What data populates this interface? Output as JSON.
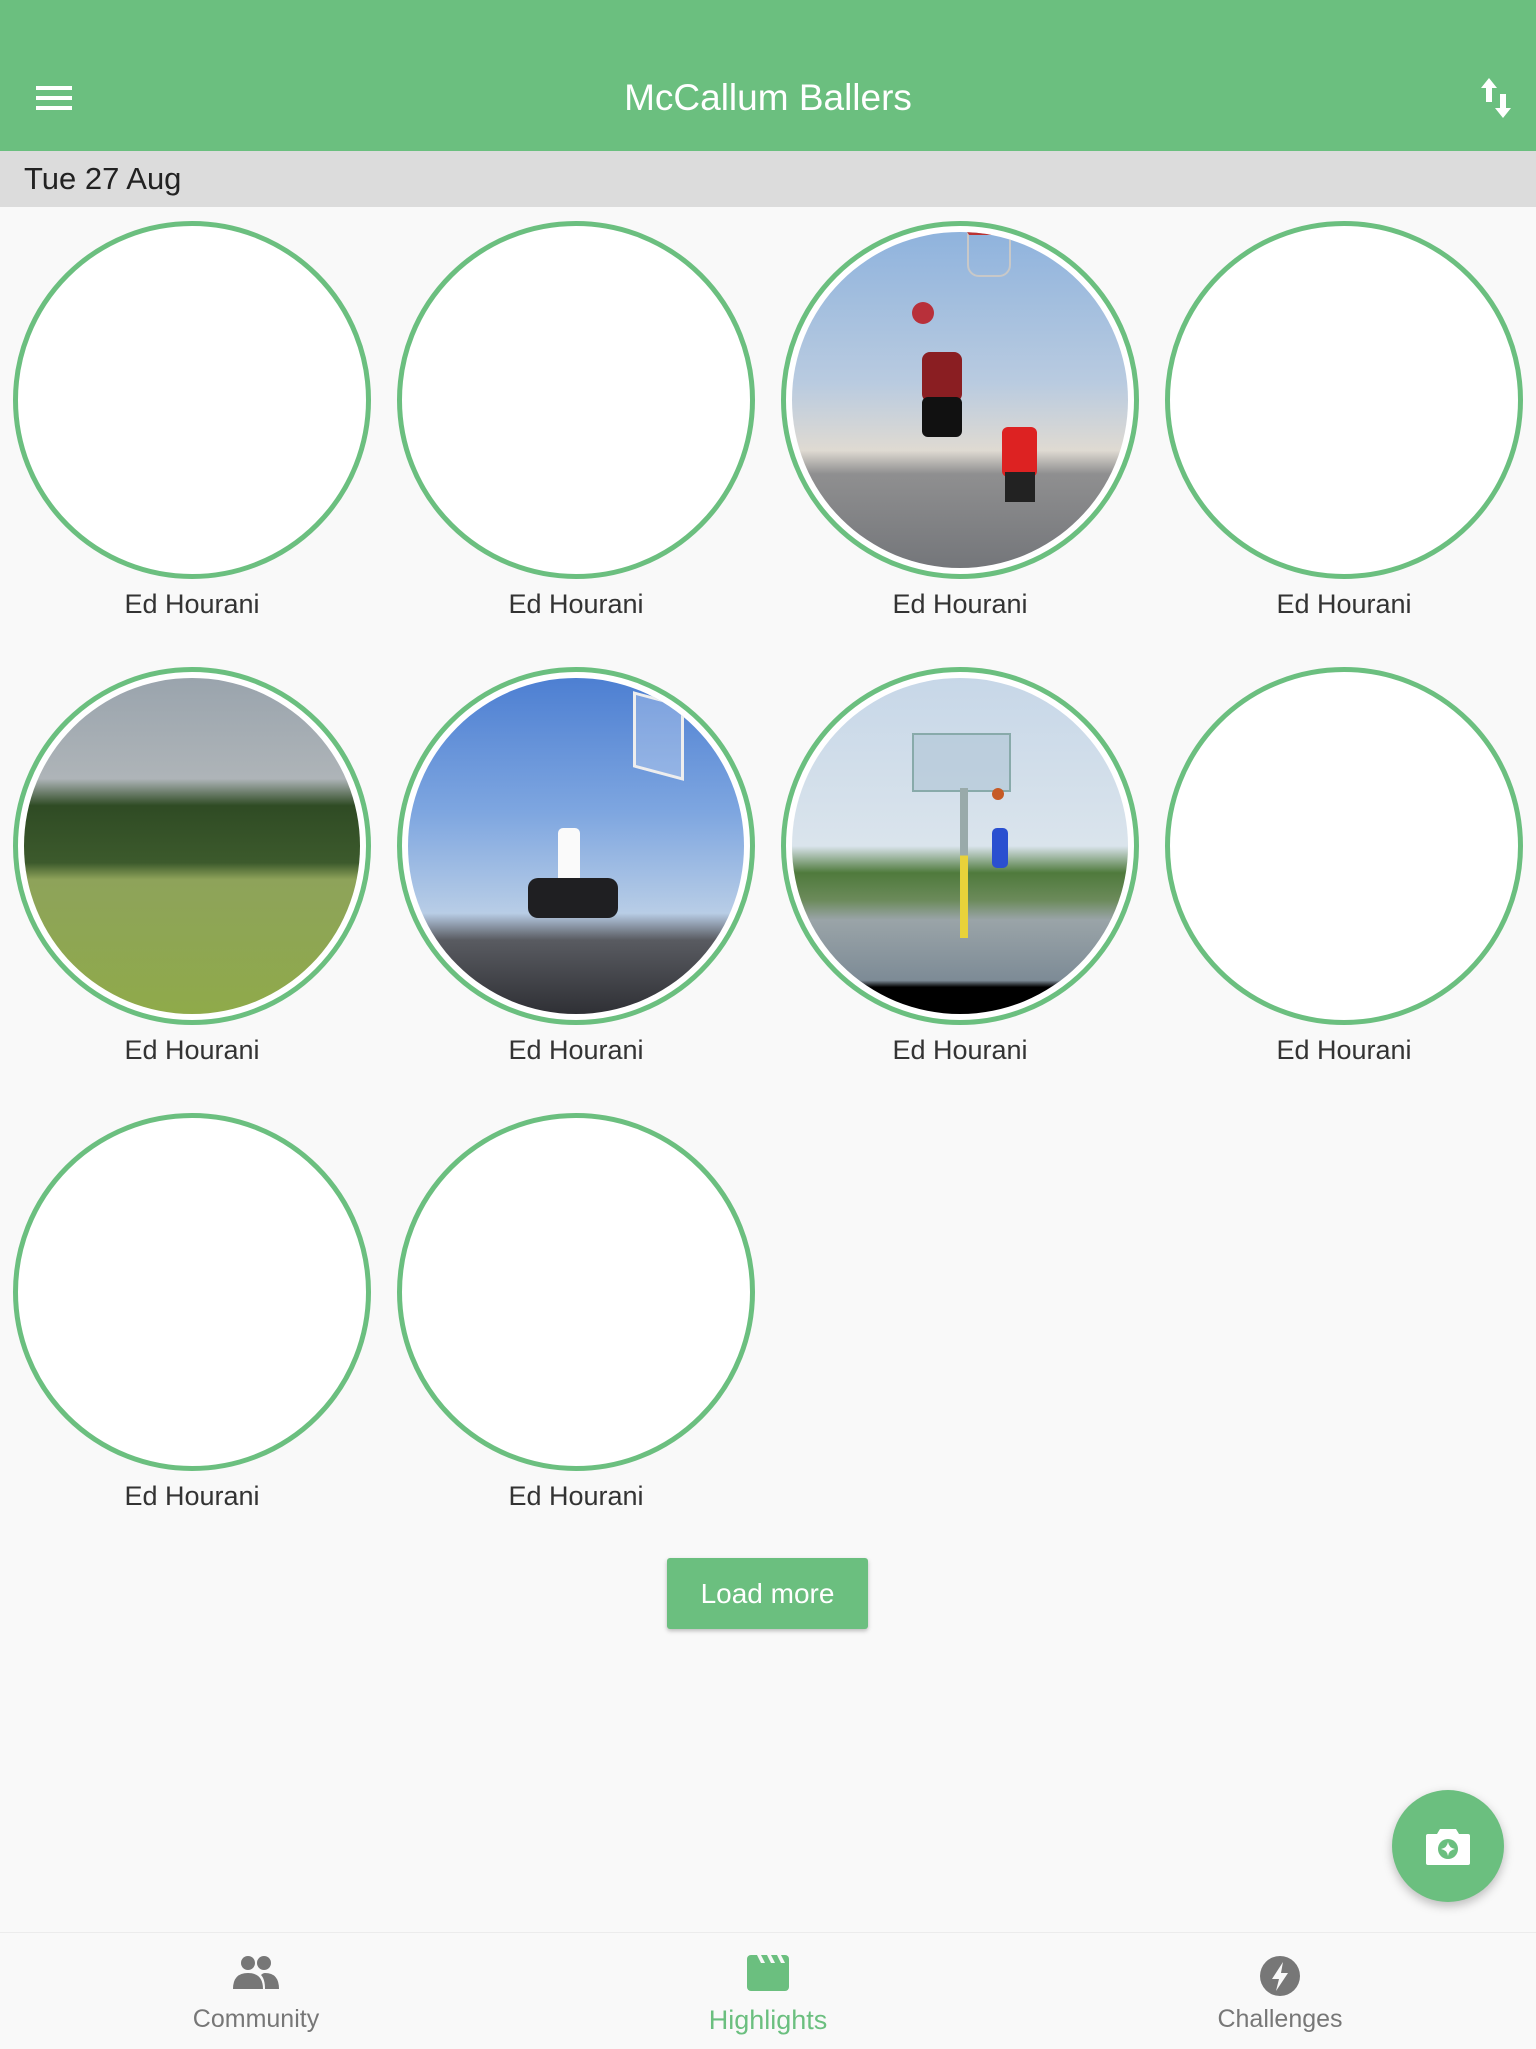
{
  "header": {
    "title": "McCallum Ballers",
    "menu_icon": "hamburger-menu-icon",
    "sort_icon": "swap-vertical-icon"
  },
  "date_header": "Tue 27 Aug",
  "highlights": [
    {
      "name": "Ed Hourani",
      "has_photo": false
    },
    {
      "name": "Ed Hourani",
      "has_photo": false
    },
    {
      "name": "Ed Hourani",
      "has_photo": true,
      "photo": "jump shot on outdoor court"
    },
    {
      "name": "Ed Hourani",
      "has_photo": false
    },
    {
      "name": "Ed Hourani",
      "has_photo": true,
      "photo": "park field with hoops"
    },
    {
      "name": "Ed Hourani",
      "has_photo": true,
      "photo": "beach court players"
    },
    {
      "name": "Ed Hourani",
      "has_photo": true,
      "photo": "girl shooting at hoop"
    },
    {
      "name": "Ed Hourani",
      "has_photo": false
    },
    {
      "name": "Ed Hourani",
      "has_photo": false
    },
    {
      "name": "Ed Hourani",
      "has_photo": false
    }
  ],
  "load_more_label": "Load more",
  "fab_icon": "add-photo-camera-icon",
  "bottom_nav": [
    {
      "label": "Community",
      "icon": "people-icon",
      "active": false
    },
    {
      "label": "Highlights",
      "icon": "clapperboard-icon",
      "active": true
    },
    {
      "label": "Challenges",
      "icon": "lightning-icon",
      "active": false
    }
  ],
  "colors": {
    "accent": "#6bbf7f",
    "date_bar": "#dcdcdc",
    "background": "#f9f9f9",
    "inactive_nav": "#777777"
  }
}
